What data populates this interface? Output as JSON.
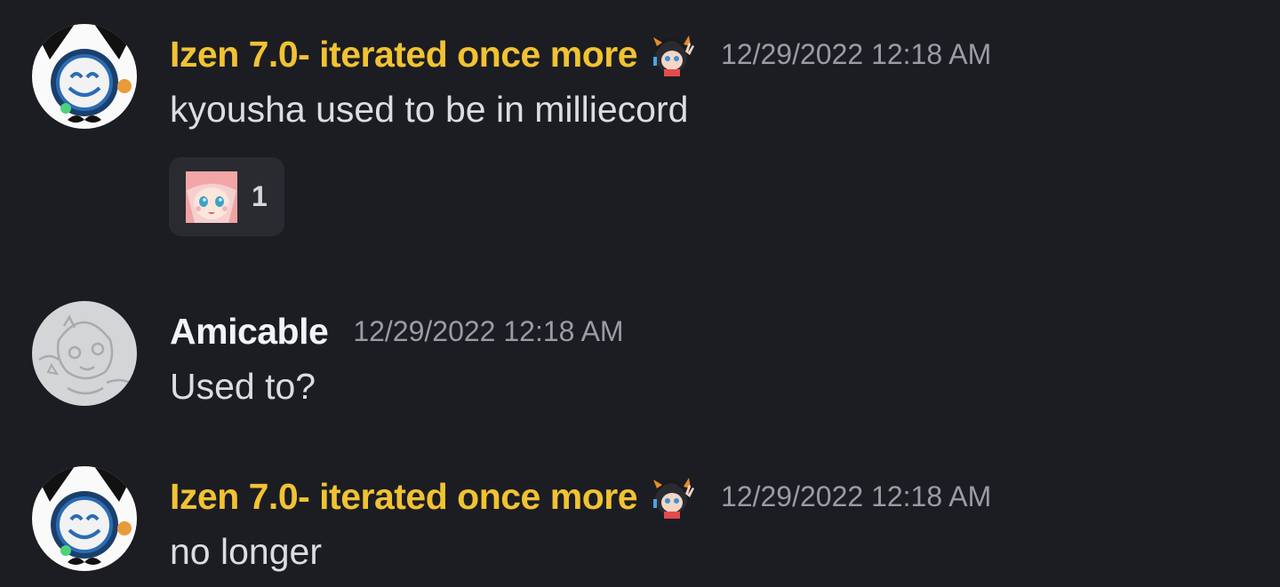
{
  "colors": {
    "background": "#1c1d22",
    "role_color_yellow": "#f1c232",
    "username_white": "#f2f3f5",
    "timestamp_gray": "#9a9ca4",
    "message_text": "#dcdde1",
    "reaction_bg": "#2a2b31"
  },
  "messages": [
    {
      "author": "Izen 7.0- iterated once more",
      "author_color": "#f1c232",
      "avatar_icon": "smiley-mustache-avatar-icon",
      "badge_icon": "anime-girl-peace-sign-icon",
      "timestamp": "12/29/2022 12:18 AM",
      "text": "kyousha used to be in milliecord",
      "reaction": {
        "emoji_icon": "pink-hair-anime-girl-emoji-icon",
        "count": "1"
      }
    },
    {
      "author": "Amicable",
      "author_color": "#f2f3f5",
      "avatar_icon": "sketch-creature-avatar-icon",
      "timestamp": "12/29/2022 12:18 AM",
      "text": "Used to?"
    },
    {
      "author": "Izen 7.0- iterated once more",
      "author_color": "#f1c232",
      "avatar_icon": "smiley-mustache-avatar-icon",
      "badge_icon": "anime-girl-peace-sign-icon",
      "timestamp": "12/29/2022 12:18 AM",
      "text": "no longer"
    }
  ]
}
